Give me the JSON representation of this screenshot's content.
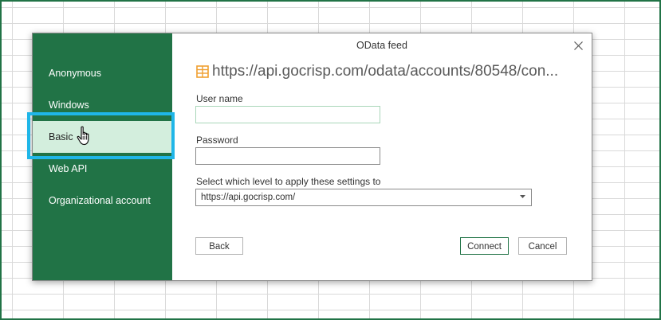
{
  "dialog": {
    "title": "OData feed",
    "url": "https://api.gocrisp.com/odata/accounts/80548/con...",
    "colors": {
      "accent": "#217346",
      "selected_bg": "#d3eedd",
      "highlight": "#1fb6e8",
      "url_icon": "#f0a030"
    }
  },
  "sidebar": {
    "items": [
      {
        "label": "Anonymous"
      },
      {
        "label": "Windows"
      },
      {
        "label": "Basic",
        "selected": true
      },
      {
        "label": "Web API"
      },
      {
        "label": "Organizational account"
      }
    ]
  },
  "form": {
    "username_label": "User name",
    "username_value": "",
    "password_label": "Password",
    "password_value": "",
    "level_label": "Select which level to apply these settings to",
    "level_value": "https://api.gocrisp.com/"
  },
  "buttons": {
    "back": "Back",
    "connect": "Connect",
    "cancel": "Cancel"
  },
  "icons": {
    "url": "table-icon",
    "close": "close-icon",
    "dropdown": "chevron-down-icon",
    "cursor": "hand-pointer-icon"
  }
}
